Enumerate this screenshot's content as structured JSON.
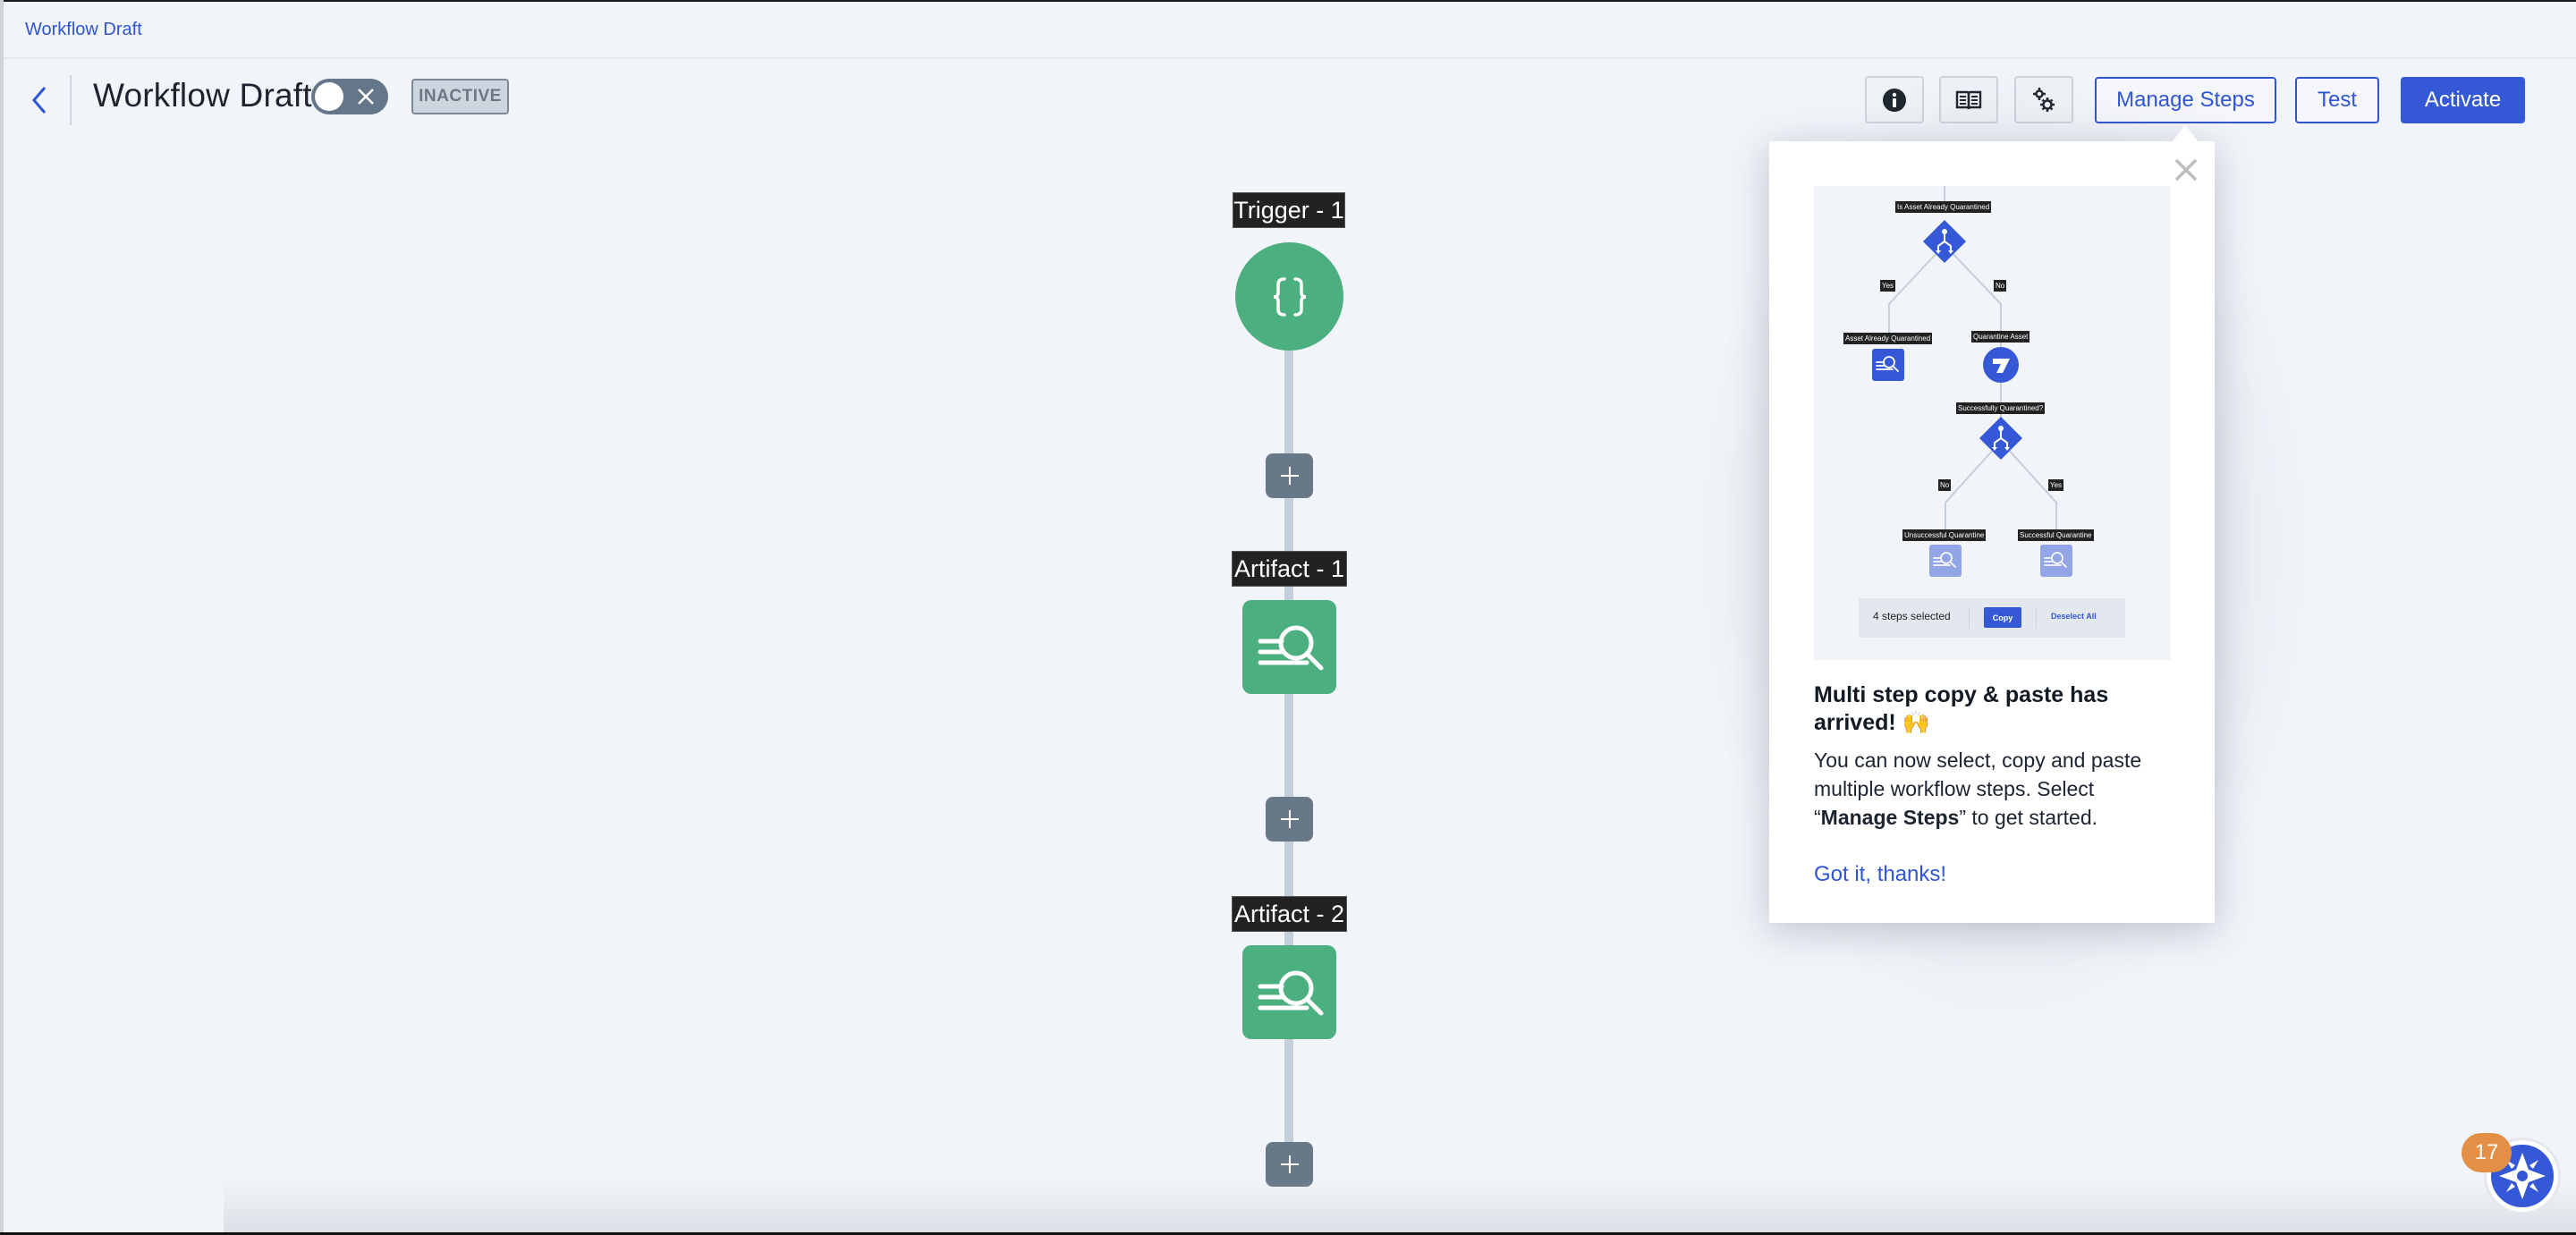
{
  "breadcrumb": "Workflow Draft",
  "header": {
    "title": "Workflow Draft",
    "toggle_state": "off",
    "status_badge": "INACTIVE",
    "icons": [
      "info-icon",
      "book-icon",
      "gears-icon"
    ],
    "buttons": {
      "manage_steps": "Manage Steps",
      "test": "Test",
      "activate": "Activate"
    }
  },
  "colors": {
    "accent": "#3458d6",
    "node_green": "#4caf80",
    "plus_grey": "#677889",
    "badge_orange": "#e38f45"
  },
  "canvas": {
    "nodes": [
      {
        "label": "Trigger - 1",
        "type": "trigger",
        "icon": "braces-icon"
      },
      {
        "label": "Artifact - 1",
        "type": "artifact",
        "icon": "artifact-search-icon"
      },
      {
        "label": "Artifact - 2",
        "type": "artifact",
        "icon": "artifact-search-icon"
      }
    ],
    "add_step_label": "+"
  },
  "popover": {
    "image": {
      "decision_1": "Is Asset Already Quarantined",
      "yes_1": "Yes",
      "no_1": "No",
      "left_node": "Asset Already Quarantined",
      "right_node": "Quarantine Asset",
      "decision_2": "Successfully Quarantined?",
      "no_2": "No",
      "yes_2": "Yes",
      "node_unsuccessful": "Unsuccessful Quarantine",
      "node_successful": "Successful Quarantine",
      "toolbar": {
        "count": "4 steps selected",
        "copy": "Copy",
        "deselect": "Deselect All"
      }
    },
    "title": "Multi step copy & paste has arrived! 🙌",
    "body_prefix": "You can now select, copy and paste multiple workflow steps. Select “",
    "body_bold": "Manage Steps",
    "body_suffix": "” to get started.",
    "link": "Got it, thanks!"
  },
  "guide": {
    "badge_count": "17"
  }
}
